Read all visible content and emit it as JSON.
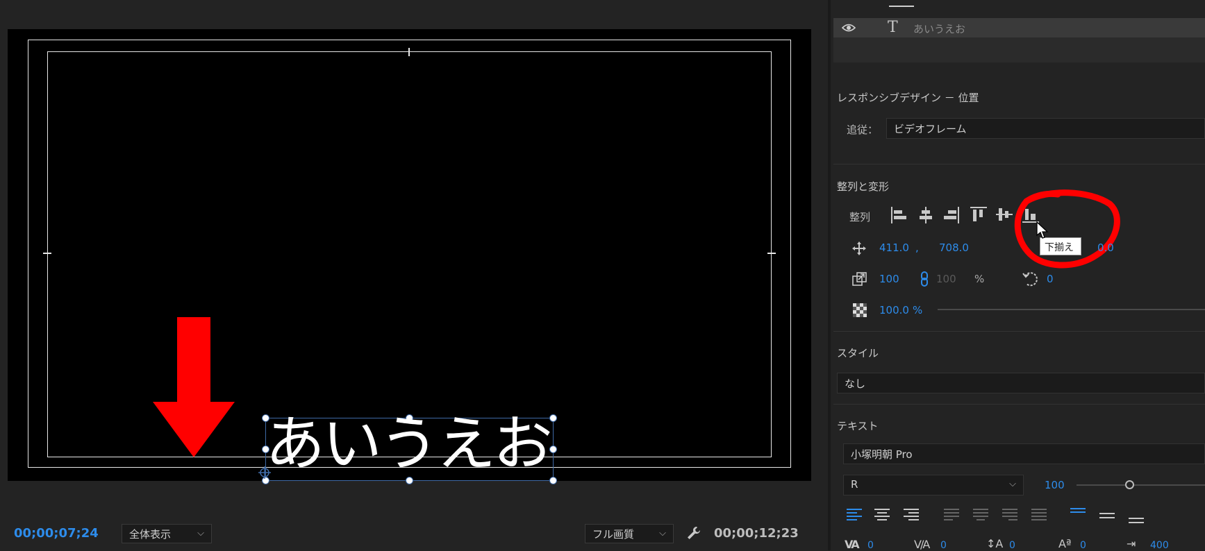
{
  "monitor": {
    "canvas_text": "あいうえお",
    "timecode_current": "00;00;07;24",
    "zoom": {
      "selected": "全体表示"
    },
    "quality": {
      "selected": "フル画質"
    },
    "timecode_end": "00;00;12;23"
  },
  "layers": {
    "items": [
      {
        "name": "あいうえお",
        "type": "text"
      }
    ]
  },
  "responsive": {
    "title": "レスポンシブデザイン － 位置",
    "follow_label": "追従：",
    "follow_value": "ビデオフレーム"
  },
  "align": {
    "title": "整列と変形",
    "align_label": "整列",
    "tooltip": "下揃え",
    "position": {
      "x": "411.0",
      "separator": ",",
      "y": "708.0"
    },
    "position_hidden_right": "0.0",
    "scale": {
      "w": "100",
      "h": "100",
      "unit": "%"
    },
    "rotation": "0",
    "opacity": "100.0",
    "opacity_unit": "%"
  },
  "style": {
    "title": "スタイル",
    "value": "なし"
  },
  "text": {
    "title": "テキスト",
    "font": "小塚明朝 Pro",
    "font_style": "R",
    "font_size": "100",
    "kerning": "0",
    "tracking": "0",
    "baseline": "0",
    "tsume": "0",
    "tab": "400"
  },
  "colors": {
    "accent": "#2d8ceb",
    "annotation": "#ff0000"
  }
}
